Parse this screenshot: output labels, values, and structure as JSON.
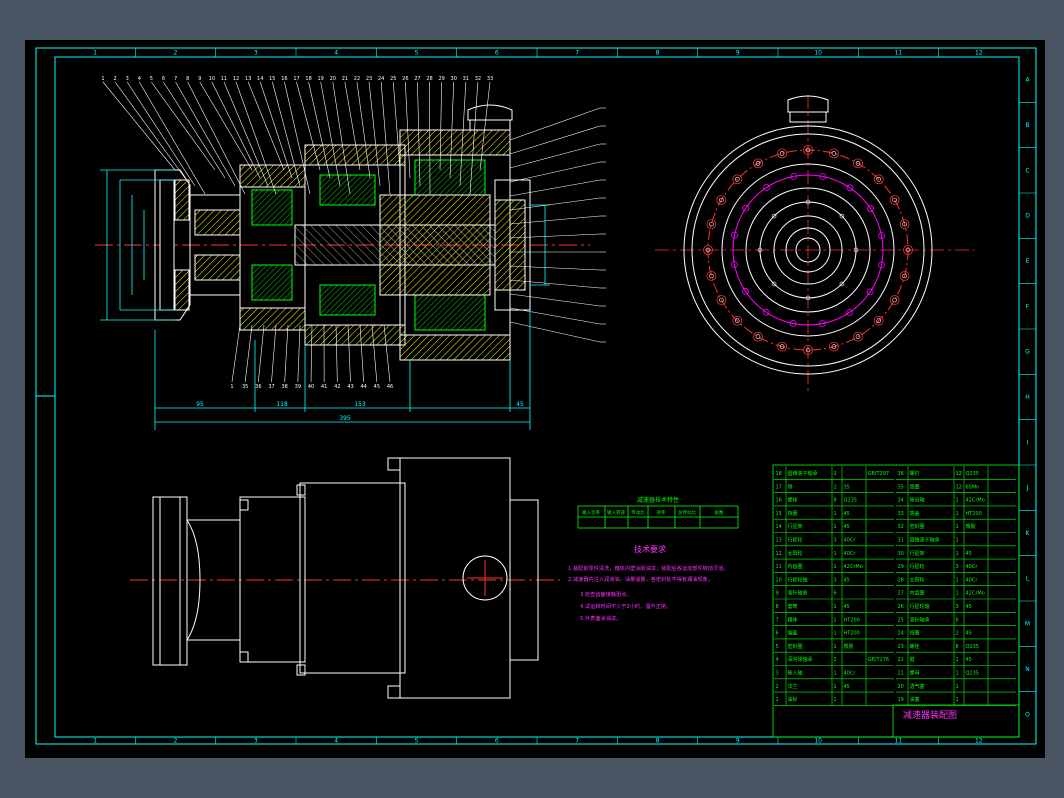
{
  "drawing": {
    "title": "减速器装配图",
    "notes_heading": "技术要求",
    "notes": [
      "1.装配前零件清洗，箱体内壁涂耐油漆；装配后各运动部件转动灵活。",
      "2.减速器内注入润滑油，油量适量，各密封处不得有漏油现象。",
      "3.检查齿面接触斑点。",
      "4.试运转时间不少于2小时，温升正常。",
      "5.外表面涂油漆。"
    ],
    "performance_table": {
      "title": "减速器技术特性",
      "headers": [
        "输入功率",
        "输入转速",
        "传动比",
        "效率",
        "总传动比",
        "级数"
      ],
      "row": [
        "",
        "",
        "",
        "",
        "",
        ""
      ]
    }
  },
  "frame": {
    "col_labels": [
      "1",
      "2",
      "3",
      "4",
      "5",
      "6",
      "7",
      "8",
      "9",
      "10",
      "11",
      "12"
    ],
    "row_labels": [
      "A",
      "B",
      "C",
      "D",
      "E",
      "F",
      "G",
      "H",
      "I",
      "J",
      "K",
      "L",
      "M",
      "N",
      "O"
    ]
  },
  "dimensions": {
    "front_spans": [
      "95",
      "118",
      "153",
      "45"
    ],
    "front_overall": "395"
  },
  "balloons": {
    "top": [
      "1",
      "2",
      "3",
      "4",
      "5",
      "6",
      "7",
      "8",
      "9",
      "10",
      "11",
      "12",
      "13",
      "14",
      "15",
      "16",
      "17",
      "18",
      "19",
      "20",
      "21",
      "22",
      "23",
      "24",
      "25",
      "26",
      "27",
      "28",
      "29",
      "30",
      "31",
      "32",
      "33"
    ],
    "bottom": [
      "1",
      "35",
      "36",
      "37",
      "38",
      "39",
      "40",
      "41",
      "42",
      "43",
      "44",
      "45",
      "46"
    ]
  },
  "bom": {
    "rows_left": [
      [
        "18",
        "圆锥滚子轴承",
        "2",
        "",
        "GB/T297"
      ],
      [
        "17",
        "销",
        "2",
        "35",
        ""
      ],
      [
        "16",
        "螺栓",
        "8",
        "Q235",
        ""
      ],
      [
        "15",
        "挡圈",
        "1",
        "45",
        ""
      ],
      [
        "14",
        "行星架",
        "1",
        "45",
        ""
      ],
      [
        "13",
        "行星轮",
        "3",
        "40Cr",
        ""
      ],
      [
        "12",
        "太阳轮",
        "1",
        "40Cr",
        ""
      ],
      [
        "11",
        "内齿圈",
        "1",
        "42CrMo",
        ""
      ],
      [
        "10",
        "行星轮轴",
        "3",
        "45",
        ""
      ],
      [
        "9",
        "滚针轴承",
        "6",
        "",
        ""
      ],
      [
        "8",
        "套筒",
        "1",
        "45",
        ""
      ],
      [
        "7",
        "箱体",
        "1",
        "HT200",
        ""
      ],
      [
        "6",
        "端盖",
        "1",
        "HT200",
        ""
      ],
      [
        "5",
        "密封圈",
        "1",
        "橡胶",
        ""
      ],
      [
        "4",
        "深沟球轴承",
        "2",
        "",
        "GB/T276"
      ],
      [
        "3",
        "输入轴",
        "1",
        "40Cr",
        ""
      ],
      [
        "2",
        "法兰",
        "1",
        "45",
        ""
      ],
      [
        "1",
        "油标",
        "1",
        "",
        ""
      ]
    ],
    "rows_right": [
      [
        "36",
        "螺钉",
        "12",
        "Q235",
        ""
      ],
      [
        "35",
        "垫圈",
        "12",
        "65Mn",
        ""
      ],
      [
        "34",
        "输出轴",
        "1",
        "42CrMo",
        ""
      ],
      [
        "33",
        "端盖",
        "1",
        "HT200",
        ""
      ],
      [
        "32",
        "密封圈",
        "1",
        "橡胶",
        ""
      ],
      [
        "31",
        "圆锥滚子轴承",
        "1",
        "",
        ""
      ],
      [
        "30",
        "行星架",
        "1",
        "45",
        ""
      ],
      [
        "29",
        "行星轮",
        "3",
        "40Cr",
        ""
      ],
      [
        "28",
        "太阳轮",
        "1",
        "40Cr",
        ""
      ],
      [
        "27",
        "内齿圈",
        "1",
        "42CrMo",
        ""
      ],
      [
        "26",
        "行星轮轴",
        "3",
        "45",
        ""
      ],
      [
        "25",
        "滚针轴承",
        "6",
        "",
        ""
      ],
      [
        "24",
        "挡圈",
        "2",
        "45",
        ""
      ],
      [
        "23",
        "螺栓",
        "8",
        "Q235",
        ""
      ],
      [
        "22",
        "键",
        "1",
        "45",
        ""
      ],
      [
        "21",
        "螺母",
        "1",
        "Q235",
        ""
      ],
      [
        "20",
        "透气塞",
        "1",
        "",
        ""
      ],
      [
        "19",
        "油塞",
        "1",
        "",
        ""
      ]
    ]
  },
  "colors": {
    "canvas": "#000000",
    "frame": "#00ffff",
    "geometry": "#ffffff",
    "dimension": "#00ffff",
    "centerline": "#ff3030",
    "table": "#00ff00",
    "notes": "#ff30ff",
    "section_hatch": "#ffff00",
    "gear": "#ff00ff"
  }
}
